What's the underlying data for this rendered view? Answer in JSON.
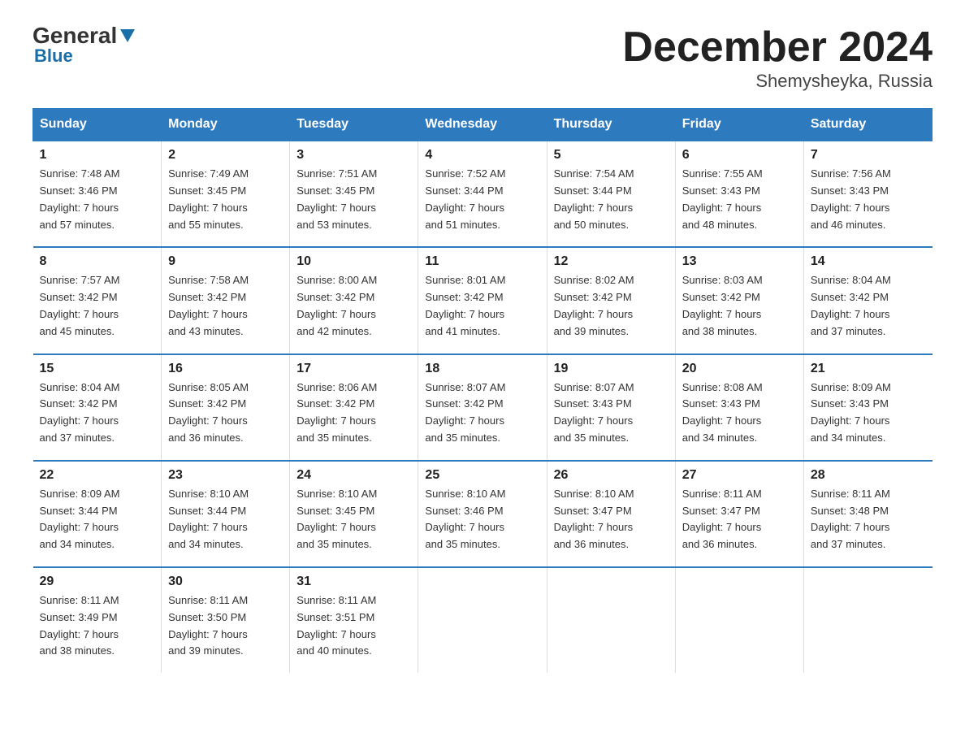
{
  "logo": {
    "general": "General",
    "blue": "Blue",
    "arrow": "▼"
  },
  "title": "December 2024",
  "subtitle": "Shemysheyka, Russia",
  "days_of_week": [
    "Sunday",
    "Monday",
    "Tuesday",
    "Wednesday",
    "Thursday",
    "Friday",
    "Saturday"
  ],
  "weeks": [
    [
      {
        "day": "1",
        "sunrise": "7:48 AM",
        "sunset": "3:46 PM",
        "daylight": "7 hours and 57 minutes."
      },
      {
        "day": "2",
        "sunrise": "7:49 AM",
        "sunset": "3:45 PM",
        "daylight": "7 hours and 55 minutes."
      },
      {
        "day": "3",
        "sunrise": "7:51 AM",
        "sunset": "3:45 PM",
        "daylight": "7 hours and 53 minutes."
      },
      {
        "day": "4",
        "sunrise": "7:52 AM",
        "sunset": "3:44 PM",
        "daylight": "7 hours and 51 minutes."
      },
      {
        "day": "5",
        "sunrise": "7:54 AM",
        "sunset": "3:44 PM",
        "daylight": "7 hours and 50 minutes."
      },
      {
        "day": "6",
        "sunrise": "7:55 AM",
        "sunset": "3:43 PM",
        "daylight": "7 hours and 48 minutes."
      },
      {
        "day": "7",
        "sunrise": "7:56 AM",
        "sunset": "3:43 PM",
        "daylight": "7 hours and 46 minutes."
      }
    ],
    [
      {
        "day": "8",
        "sunrise": "7:57 AM",
        "sunset": "3:42 PM",
        "daylight": "7 hours and 45 minutes."
      },
      {
        "day": "9",
        "sunrise": "7:58 AM",
        "sunset": "3:42 PM",
        "daylight": "7 hours and 43 minutes."
      },
      {
        "day": "10",
        "sunrise": "8:00 AM",
        "sunset": "3:42 PM",
        "daylight": "7 hours and 42 minutes."
      },
      {
        "day": "11",
        "sunrise": "8:01 AM",
        "sunset": "3:42 PM",
        "daylight": "7 hours and 41 minutes."
      },
      {
        "day": "12",
        "sunrise": "8:02 AM",
        "sunset": "3:42 PM",
        "daylight": "7 hours and 39 minutes."
      },
      {
        "day": "13",
        "sunrise": "8:03 AM",
        "sunset": "3:42 PM",
        "daylight": "7 hours and 38 minutes."
      },
      {
        "day": "14",
        "sunrise": "8:04 AM",
        "sunset": "3:42 PM",
        "daylight": "7 hours and 37 minutes."
      }
    ],
    [
      {
        "day": "15",
        "sunrise": "8:04 AM",
        "sunset": "3:42 PM",
        "daylight": "7 hours and 37 minutes."
      },
      {
        "day": "16",
        "sunrise": "8:05 AM",
        "sunset": "3:42 PM",
        "daylight": "7 hours and 36 minutes."
      },
      {
        "day": "17",
        "sunrise": "8:06 AM",
        "sunset": "3:42 PM",
        "daylight": "7 hours and 35 minutes."
      },
      {
        "day": "18",
        "sunrise": "8:07 AM",
        "sunset": "3:42 PM",
        "daylight": "7 hours and 35 minutes."
      },
      {
        "day": "19",
        "sunrise": "8:07 AM",
        "sunset": "3:43 PM",
        "daylight": "7 hours and 35 minutes."
      },
      {
        "day": "20",
        "sunrise": "8:08 AM",
        "sunset": "3:43 PM",
        "daylight": "7 hours and 34 minutes."
      },
      {
        "day": "21",
        "sunrise": "8:09 AM",
        "sunset": "3:43 PM",
        "daylight": "7 hours and 34 minutes."
      }
    ],
    [
      {
        "day": "22",
        "sunrise": "8:09 AM",
        "sunset": "3:44 PM",
        "daylight": "7 hours and 34 minutes."
      },
      {
        "day": "23",
        "sunrise": "8:10 AM",
        "sunset": "3:44 PM",
        "daylight": "7 hours and 34 minutes."
      },
      {
        "day": "24",
        "sunrise": "8:10 AM",
        "sunset": "3:45 PM",
        "daylight": "7 hours and 35 minutes."
      },
      {
        "day": "25",
        "sunrise": "8:10 AM",
        "sunset": "3:46 PM",
        "daylight": "7 hours and 35 minutes."
      },
      {
        "day": "26",
        "sunrise": "8:10 AM",
        "sunset": "3:47 PM",
        "daylight": "7 hours and 36 minutes."
      },
      {
        "day": "27",
        "sunrise": "8:11 AM",
        "sunset": "3:47 PM",
        "daylight": "7 hours and 36 minutes."
      },
      {
        "day": "28",
        "sunrise": "8:11 AM",
        "sunset": "3:48 PM",
        "daylight": "7 hours and 37 minutes."
      }
    ],
    [
      {
        "day": "29",
        "sunrise": "8:11 AM",
        "sunset": "3:49 PM",
        "daylight": "7 hours and 38 minutes."
      },
      {
        "day": "30",
        "sunrise": "8:11 AM",
        "sunset": "3:50 PM",
        "daylight": "7 hours and 39 minutes."
      },
      {
        "day": "31",
        "sunrise": "8:11 AM",
        "sunset": "3:51 PM",
        "daylight": "7 hours and 40 minutes."
      },
      null,
      null,
      null,
      null
    ]
  ]
}
